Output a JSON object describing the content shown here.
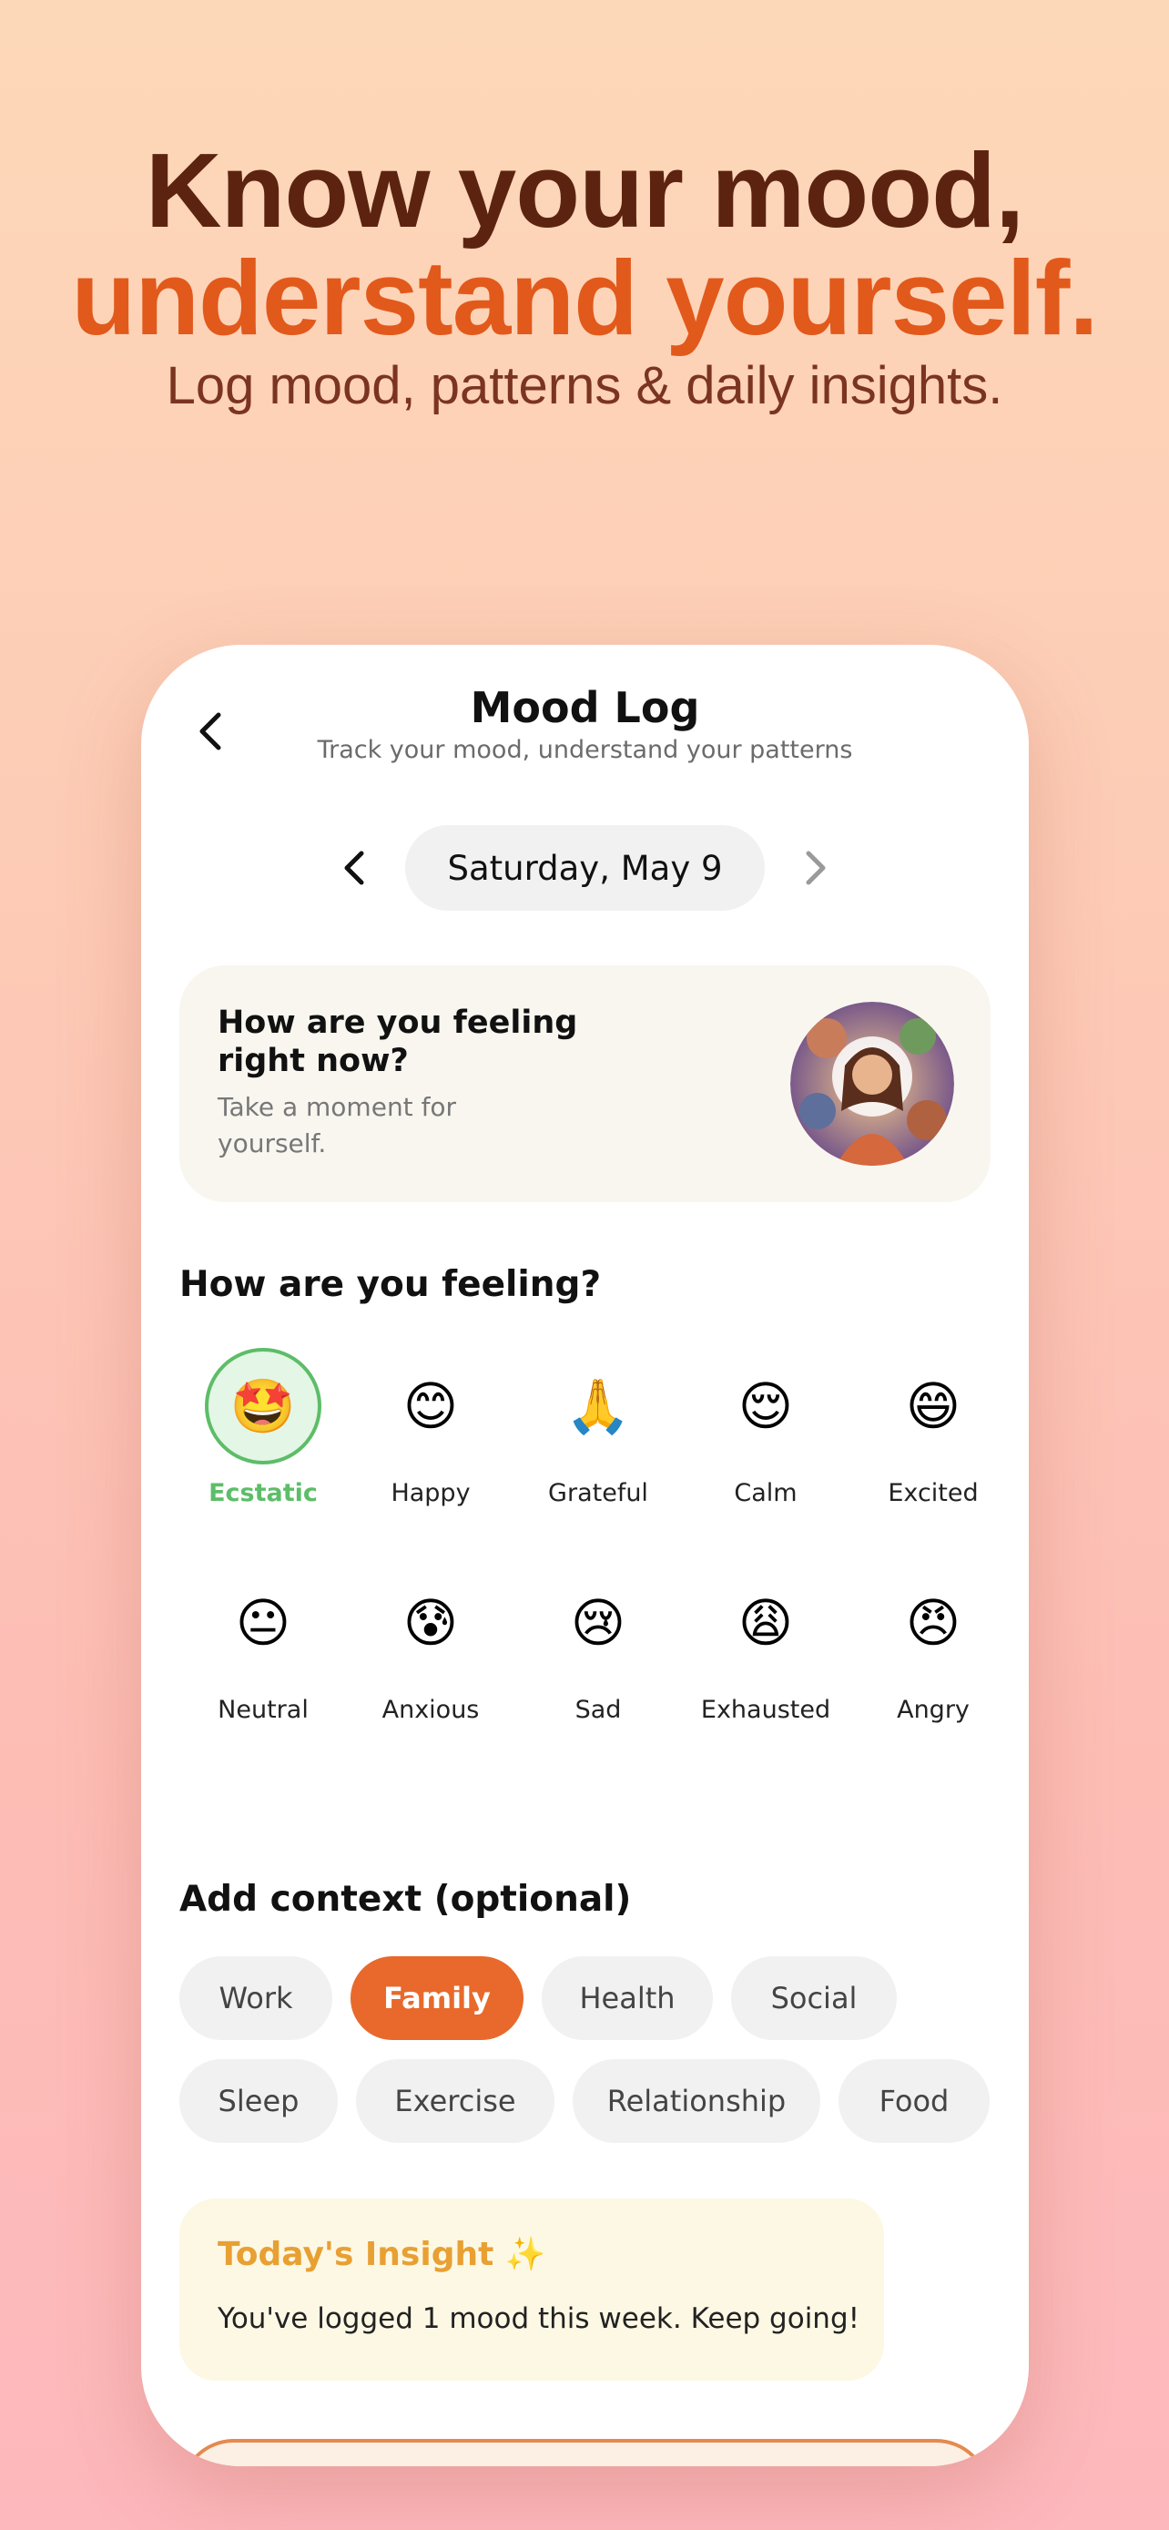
{
  "hero": {
    "line1": "Know your mood,",
    "line2": "understand yourself.",
    "subtitle": "Log mood, patterns & daily insights."
  },
  "header": {
    "title": "Mood Log",
    "subtitle": "Track your mood, understand your patterns"
  },
  "date": {
    "label": "Saturday, May 9"
  },
  "feeling_card": {
    "title": "How are you feeling right now?",
    "subtitle": "Take a moment for yourself."
  },
  "moods_section": {
    "heading": "How are you feeling?",
    "selected": "Ecstatic",
    "items": [
      {
        "label": "Ecstatic",
        "emoji": "🤩",
        "icon": "star-struck-icon"
      },
      {
        "label": "Happy",
        "emoji": "😊",
        "icon": "smiling-face-icon"
      },
      {
        "label": "Grateful",
        "emoji": "🙏",
        "icon": "folded-hands-icon"
      },
      {
        "label": "Calm",
        "emoji": "😌",
        "icon": "relieved-face-icon"
      },
      {
        "label": "Excited",
        "emoji": "😄",
        "icon": "grinning-face-icon"
      },
      {
        "label": "Neutral",
        "emoji": "😐",
        "icon": "neutral-face-icon"
      },
      {
        "label": "Anxious",
        "emoji": "😰",
        "icon": "anxious-face-icon"
      },
      {
        "label": "Sad",
        "emoji": "😢",
        "icon": "crying-face-icon"
      },
      {
        "label": "Exhausted",
        "emoji": "😩",
        "icon": "weary-face-icon"
      },
      {
        "label": "Angry",
        "emoji": "😠",
        "icon": "angry-face-icon"
      }
    ]
  },
  "context_section": {
    "heading": "Add context (optional)",
    "selected": "Family",
    "chips": [
      "Work",
      "Family",
      "Health",
      "Social",
      "Sleep",
      "Exercise",
      "Relationship",
      "Food"
    ]
  },
  "insight": {
    "title": "Today's Insight ✨",
    "text": "You've logged 1 mood this week. Keep going!"
  },
  "colors": {
    "accent": "#e8692b",
    "selected_mood": "#5dbd68",
    "insight_title": "#e8a033",
    "hero_dark": "#5c2410",
    "hero_orange": "#e2591c"
  }
}
